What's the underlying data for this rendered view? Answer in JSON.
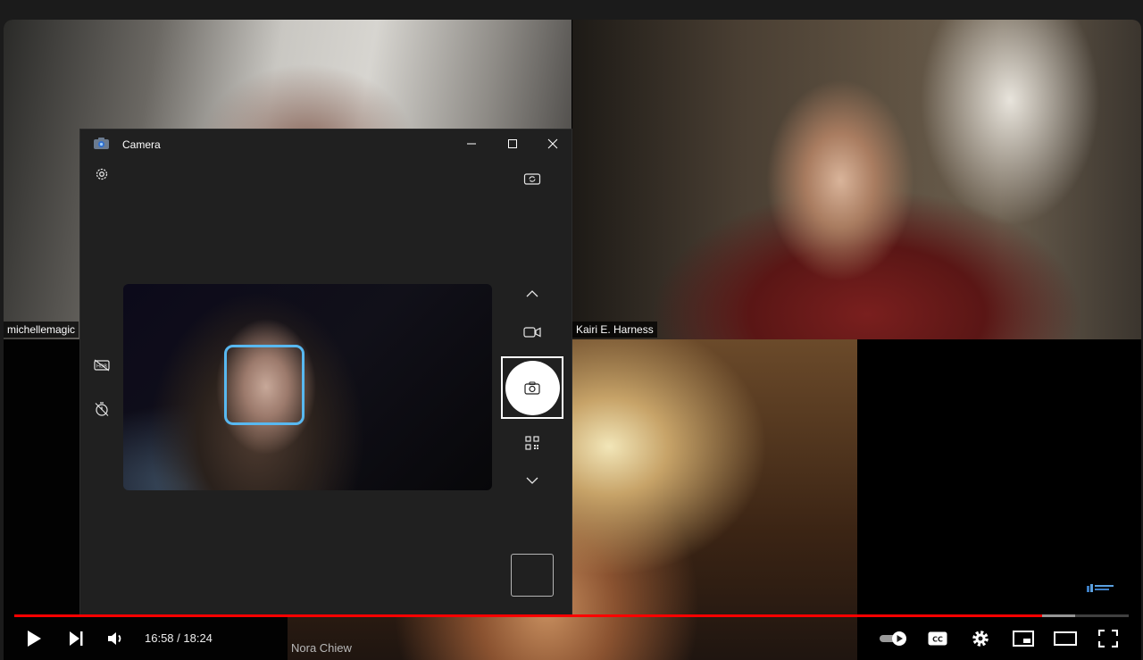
{
  "meeting": {
    "participants": [
      {
        "name": "michellemagic"
      },
      {
        "name": "Kairi E. Harness"
      },
      {
        "name": "Nora Chiew"
      }
    ]
  },
  "camera_app": {
    "title": "Camera",
    "icons": {
      "settings": "gear-icon",
      "switch_camera": "switch-camera-icon",
      "hdr": "hdr-off-icon",
      "timer": "timer-off-icon",
      "scroll_up": "chevron-up-icon",
      "video_mode": "video-camera-icon",
      "photo_mode": "camera-icon",
      "qr_mode": "qr-code-icon",
      "scroll_down": "chevron-down-icon"
    },
    "face_detection_color": "#58b8f0"
  },
  "player": {
    "current_time": "16:58",
    "duration": "18:24",
    "time_text": "16:58 / 18:24",
    "progress_fraction": 0.9221,
    "buffered_fraction": 0.9519,
    "progress_color": "#ff0000",
    "controls": [
      "play-icon",
      "next-icon",
      "volume-icon",
      "autoplay-toggle-icon",
      "cc-icon",
      "gear-icon",
      "miniplayer-icon",
      "theater-icon",
      "fullscreen-icon"
    ]
  }
}
